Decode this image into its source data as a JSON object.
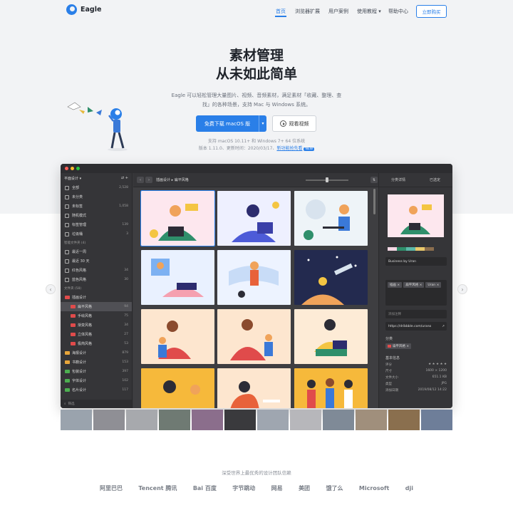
{
  "brand": {
    "name": "Eagle",
    "accent": "#2a7fe8"
  },
  "nav": {
    "items": [
      {
        "label": "首页",
        "active": true
      },
      {
        "label": "浏览器扩展"
      },
      {
        "label": "用户案例"
      },
      {
        "label": "使用教程 ▾"
      },
      {
        "label": "帮助中心"
      }
    ],
    "buy": "立即购买"
  },
  "hero": {
    "title_line1": "素材管理",
    "title_line2": "从未如此简单",
    "desc_line1": "Eagle 可以轻松管理大量图片、视频、音频素材，满足素材「收藏、整理、查",
    "desc_line2": "找」的各种场景，支持 Mac 与 Windows 系统。",
    "download": "免费下载 macOS 版",
    "download_caret": "▾",
    "video": "观看视频",
    "support": "支持 macOS 10.11+ 和 Windows 7+ 64 位系统",
    "version": "版本 1.11.0、更新时间：2020/03/17、",
    "version_link": "新功能抢先看",
    "version_badge": "NEW"
  },
  "app": {
    "sidebar": {
      "header": "平面设计 ▾",
      "header_icons": "⇄  +",
      "items": [
        {
          "label": "全部",
          "count": "2,528"
        },
        {
          "label": "未分类",
          "count": ""
        },
        {
          "label": "未标签",
          "count": "1,058"
        },
        {
          "label": "随机模式",
          "count": ""
        },
        {
          "label": "标签管理",
          "count": "139"
        },
        {
          "label": "垃圾桶",
          "count": "3"
        }
      ],
      "smart_section": "智能文件夹 (4)",
      "smart": [
        {
          "label": "最近一周",
          "count": ""
        },
        {
          "label": "最近 30 天",
          "count": ""
        },
        {
          "label": "红色风格",
          "count": "34"
        },
        {
          "label": "蓝色风格",
          "count": "30"
        }
      ],
      "folder_section": "文件夹 (58)",
      "folders": [
        {
          "label": "插画设计",
          "count": "",
          "color": "#e04b4b",
          "level": 0
        },
        {
          "label": "扁平风格",
          "count": "94",
          "color": "#e04b4b",
          "level": 1,
          "selected": true
        },
        {
          "label": "手绘风格",
          "count": "75",
          "color": "#e04b4b",
          "level": 1
        },
        {
          "label": "渐变风格",
          "count": "34",
          "color": "#e04b4b",
          "level": 1
        },
        {
          "label": "立体风格",
          "count": "27",
          "color": "#e04b4b",
          "level": 1
        },
        {
          "label": "极简风格",
          "count": "53",
          "color": "#e04b4b",
          "level": 1
        },
        {
          "label": "海报设计",
          "count": "879",
          "color": "#e8a53a",
          "level": 0
        },
        {
          "label": "书籍设计",
          "count": "153",
          "color": "#e8a53a",
          "level": 0
        },
        {
          "label": "包装设计",
          "count": "397",
          "color": "#4caf50",
          "level": 0
        },
        {
          "label": "字体设计",
          "count": "102",
          "color": "#4caf50",
          "level": 0
        },
        {
          "label": "名片设计",
          "count": "117",
          "color": "#4caf50",
          "level": 0
        }
      ],
      "filter": "筛选"
    },
    "toolbar": {
      "breadcrumb": "插画设计 ▸ 扁平风格",
      "search": "搜索"
    },
    "inspector": {
      "tab1": "分类详情",
      "tab2": "已选定",
      "name": "Business by Uran",
      "tags": [
        "插画 ×",
        "扁平风格 ×",
        "Uran ×"
      ],
      "note": "添加注释",
      "url": "https://dribbble.com/urano",
      "folder_label": "分类",
      "folder_value": "扁平风格 ×",
      "info_label": "基本信息",
      "info": [
        {
          "k": "评分",
          "v": "★ ★ ★ ★ ★"
        },
        {
          "k": "尺寸",
          "v": "1600 × 1200"
        },
        {
          "k": "文件大小",
          "v": "651.1 KB"
        },
        {
          "k": "类型",
          "v": "JPG"
        },
        {
          "k": "添加日期",
          "v": "2019/08/12 14:22"
        }
      ],
      "swatches": [
        "#f4d7e4",
        "#2f8f6b",
        "#5bb8a8",
        "#e9c86b",
        "#8b6e4e"
      ]
    }
  },
  "clients": {
    "title": "深受世界上最优秀的设计团队信赖",
    "logos": [
      "阿里巴巴",
      "Tencent 腾讯",
      "Bai 百度",
      "字节跳动",
      "网易",
      "美团",
      "饿了么",
      "Microsoft",
      "dji"
    ]
  }
}
